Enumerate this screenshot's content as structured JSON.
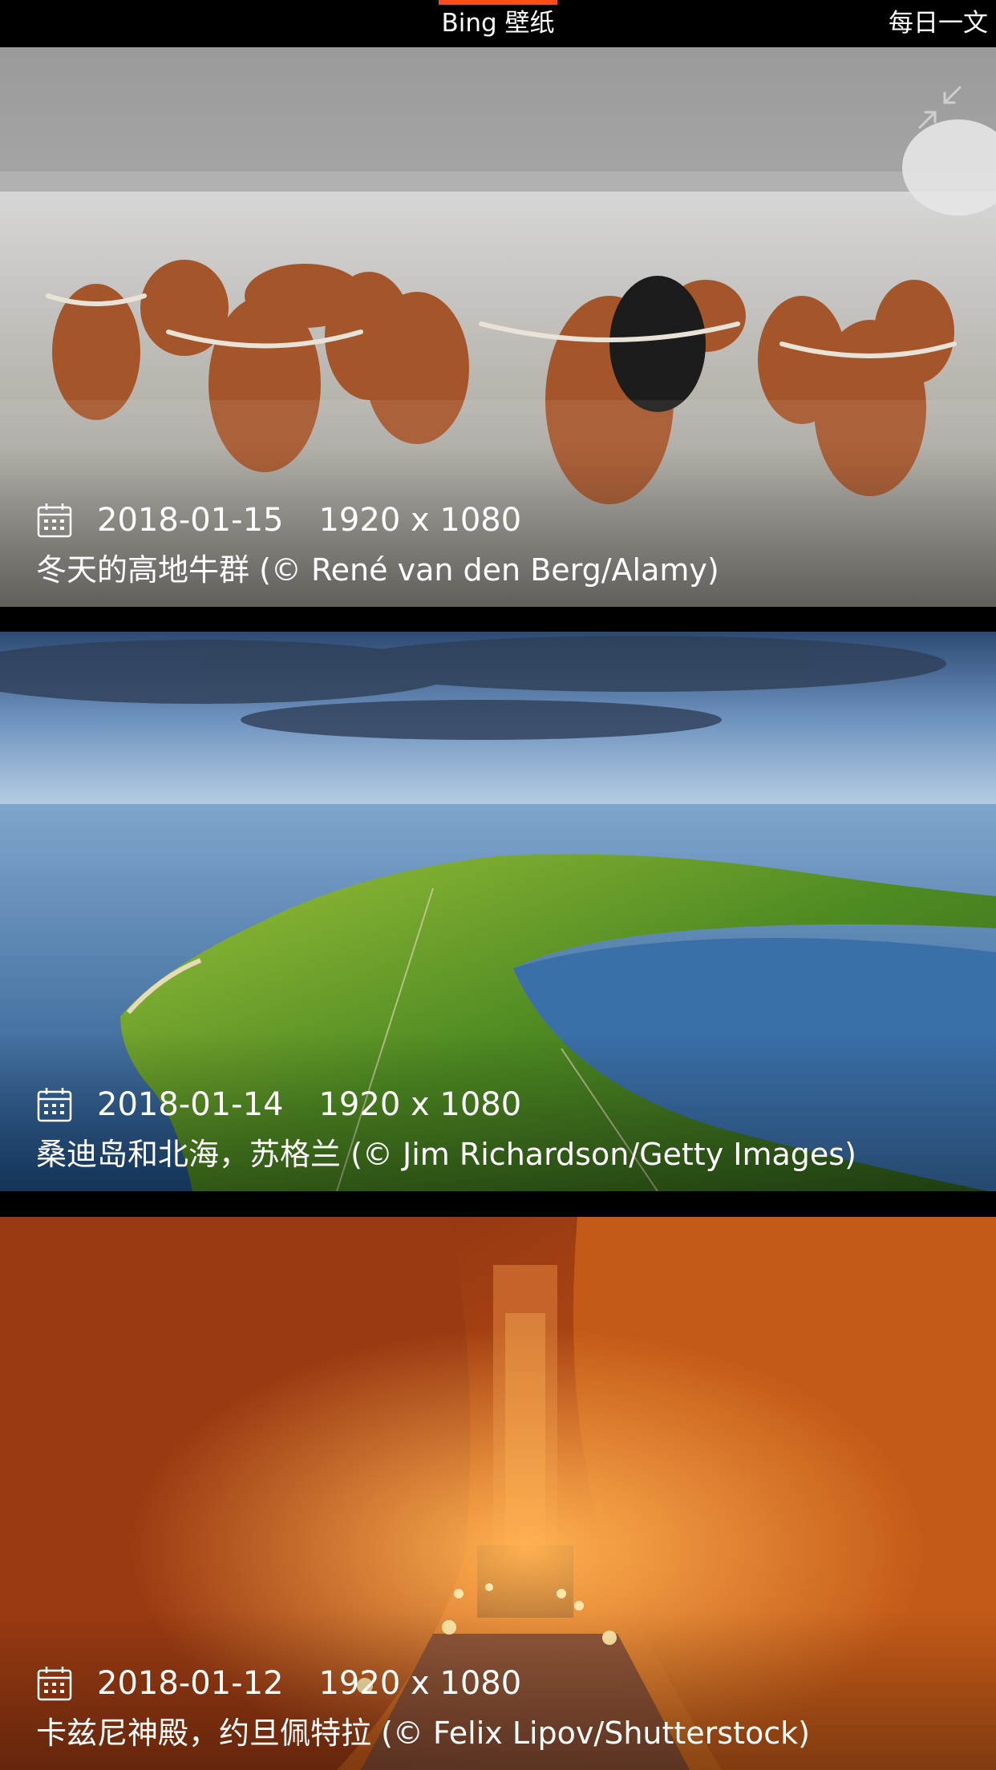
{
  "tabs": {
    "bing": "Bing 壁纸",
    "daily": "每日一文"
  },
  "colors": {
    "accent": "#ff4b1f",
    "background": "#000000"
  },
  "icons": {
    "calendar": "calendar-icon",
    "collapse": "collapse-icon"
  },
  "wallpapers": [
    {
      "date": "2018-01-15",
      "resolution": "1920 x 1080",
      "caption": "冬天的高地牛群 (© René van den Berg/Alamy)"
    },
    {
      "date": "2018-01-14",
      "resolution": "1920 x 1080",
      "caption": "桑迪岛和北海，苏格兰 (© Jim Richardson/Getty Images)"
    },
    {
      "date": "2018-01-12",
      "resolution": "1920 x 1080",
      "caption": "卡兹尼神殿，约旦佩特拉 (© Felix Lipov/Shutterstock)"
    }
  ]
}
